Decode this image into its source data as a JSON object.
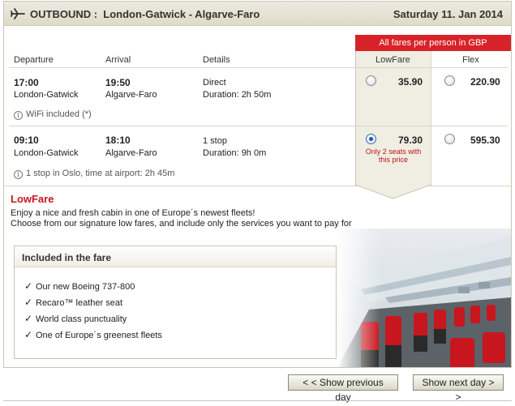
{
  "header": {
    "direction": "OUTBOUND :",
    "route": "London-Gatwick - Algarve-Faro",
    "date": "Saturday 11. Jan 2014"
  },
  "fare_note": "All fares per person in GBP",
  "columns": {
    "departure": "Departure",
    "arrival": "Arrival",
    "details": "Details",
    "lowfare": "LowFare",
    "flex": "Flex"
  },
  "flights": [
    {
      "dep_time": "17:00",
      "dep_airport": "London-Gatwick",
      "arr_time": "19:50",
      "arr_airport": "Algarve-Faro",
      "stops": "Direct",
      "duration": "Duration: 2h 50m",
      "info": "WiFi included (*)",
      "lowfare_price": "35.90",
      "flex_price": "220.90",
      "selected": "none"
    },
    {
      "dep_time": "09:10",
      "dep_airport": "London-Gatwick",
      "arr_time": "18:10",
      "arr_airport": "Algarve-Faro",
      "stops": "1 stop",
      "duration": "Duration: 9h 0m",
      "info": "1 stop in Oslo, time at airport: 2h 45m",
      "lowfare_price": "79.30",
      "lowfare_note_1": "Only 2 seats with",
      "lowfare_note_2": "this price",
      "flex_price": "595.30",
      "selected": "lowfare"
    }
  ],
  "promo": {
    "title": "LowFare",
    "line1": "Enjoy a nice and fresh cabin in one of Europe´s newest fleets!",
    "line2": "Choose from our signature low fares, and include only the services you want to pay for",
    "included_title": "Included in the fare",
    "included": [
      "Our new Boeing 737-800",
      "Recaro™ leather seat",
      "World class punctuality",
      "One of Europe´s greenest fleets"
    ]
  },
  "buttons": {
    "prev": "< < Show previous day",
    "next": "Show next day > >"
  },
  "icons": {
    "header": "airplane-icon",
    "info": "info-icon",
    "check": "checkmark-icon"
  },
  "colors": {
    "accent_red": "#d8222a",
    "header_bg": "#dedbc8",
    "selected_column": "#f0eee2"
  }
}
